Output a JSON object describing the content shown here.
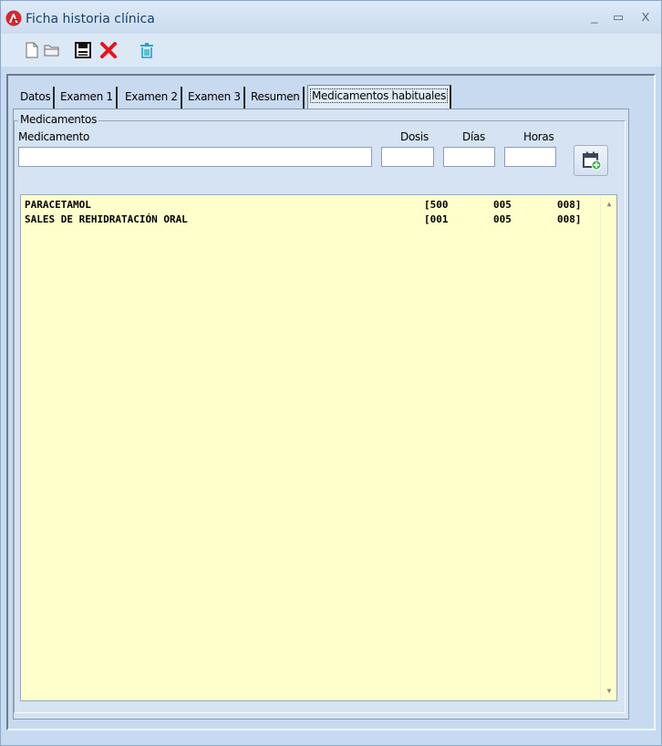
{
  "window": {
    "title": "Ficha historia clínica",
    "min_glyph": "_",
    "max_glyph": "▭",
    "close_glyph": "X",
    "icons": [
      "app-logo-icon",
      "new-document-icon",
      "open-folder-icon",
      "save-icon",
      "delete-icon",
      "trash-icon"
    ]
  },
  "tabs": [
    {
      "label": "Datos"
    },
    {
      "label": "Examen 1"
    },
    {
      "label": "Examen 2"
    },
    {
      "label": "Examen 3"
    },
    {
      "label": "Resumen"
    },
    {
      "label": "Medicamentos habituales"
    }
  ],
  "active_tab": "Medicamentos habituales",
  "group": {
    "label": "Medicamentos",
    "fields": {
      "medicamento_label": "Medicamento",
      "medicamento_value": "",
      "dosis_label": "Dosis",
      "dosis_value": "",
      "dias_label": "Días",
      "dias_value": "",
      "horas_label": "Horas",
      "horas_value": ""
    }
  },
  "medications": [
    {
      "name": "PARACETAMOL",
      "dosis": "[500",
      "dias": "005",
      "horas": "008]"
    },
    {
      "name": "SALES DE REHIDRATACIÓN ORAL",
      "dosis": "[001",
      "dias": "005",
      "horas": "008]"
    }
  ],
  "colors": {
    "list_background": "#ffffcc",
    "window_background": "#c7daf0",
    "delete_red": "#e8141b",
    "trash_teal": "#1aa6c7"
  }
}
